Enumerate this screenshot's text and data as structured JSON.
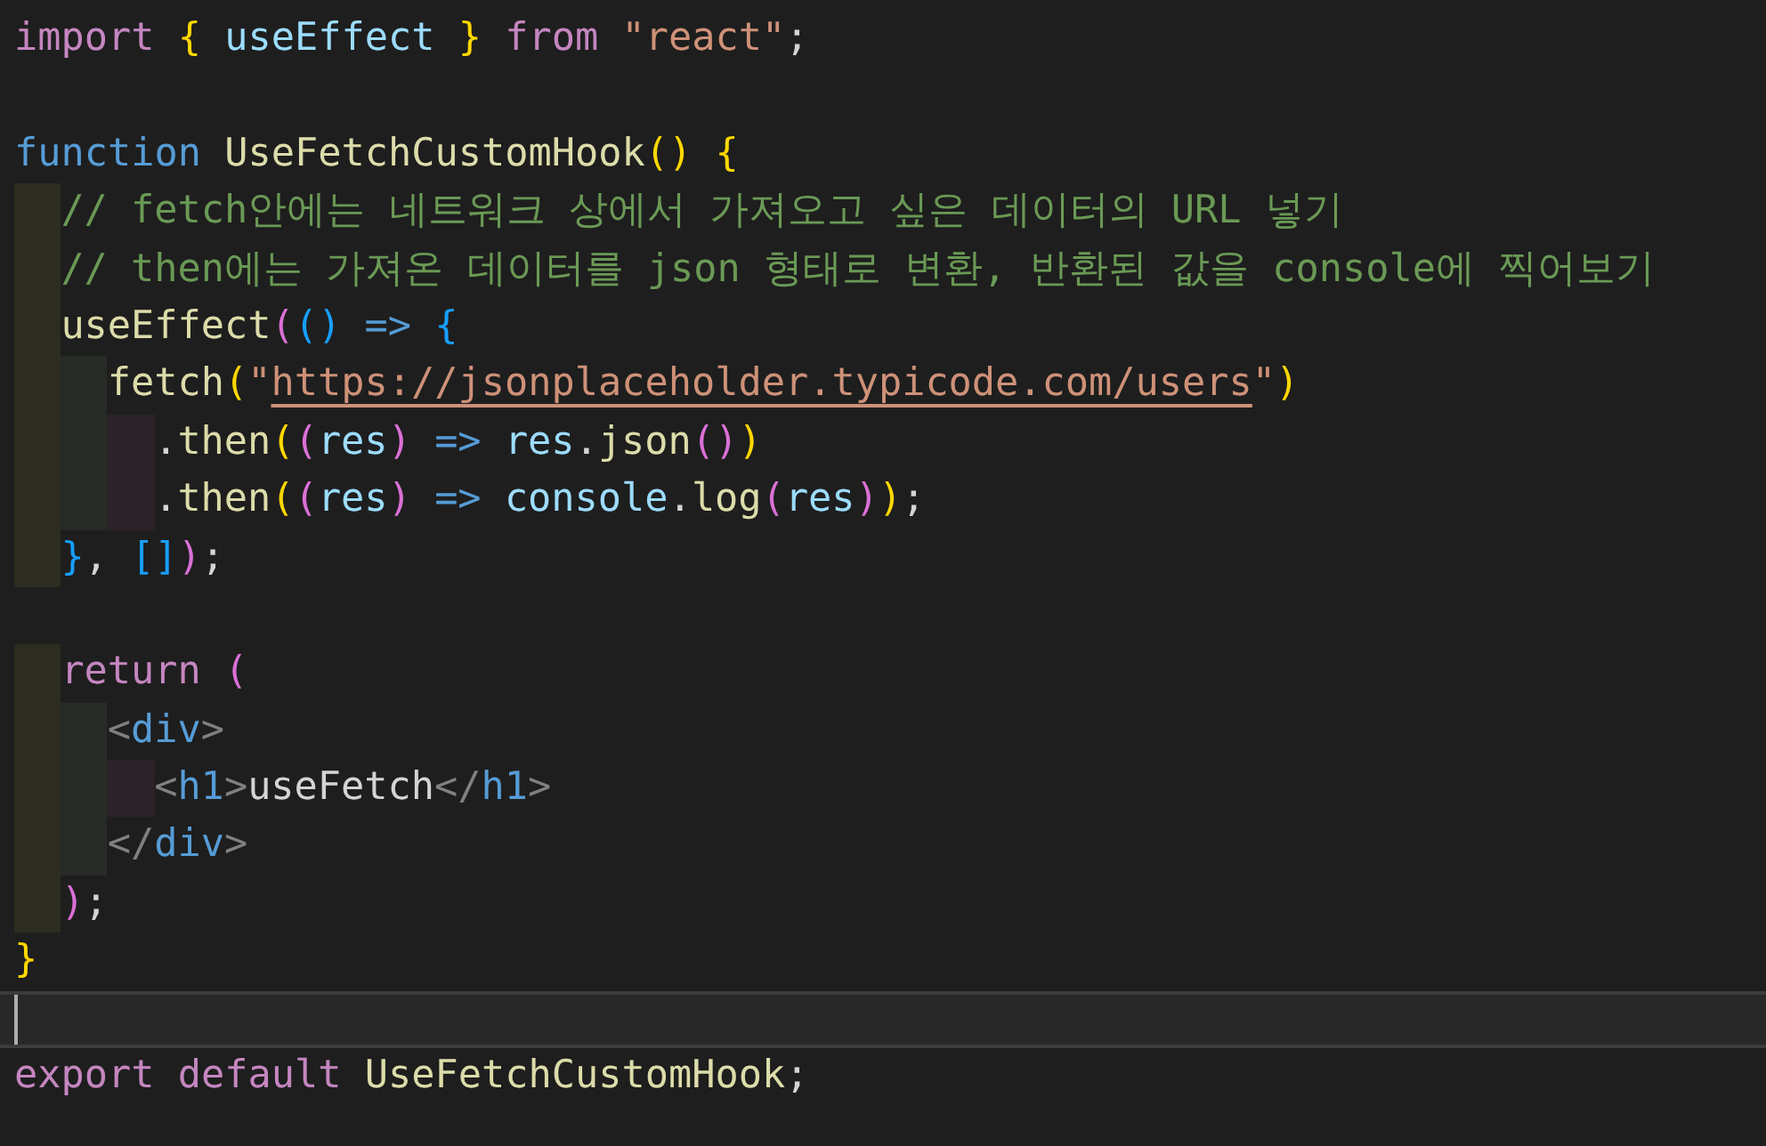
{
  "editor": {
    "lines": [
      {
        "cursor": false,
        "tokens": [
          {
            "kind": "keyword",
            "text": "import "
          },
          {
            "kind": "bracket1",
            "text": "{"
          },
          {
            "kind": "variable",
            "text": " useEffect "
          },
          {
            "kind": "bracket1",
            "text": "} "
          },
          {
            "kind": "keyword",
            "text": "from "
          },
          {
            "kind": "string",
            "text": "\"react\""
          },
          {
            "kind": "punct",
            "text": ";"
          }
        ]
      },
      {
        "cursor": false
      },
      {
        "cursor": false,
        "tokens": [
          {
            "kind": "storage",
            "text": "function "
          },
          {
            "kind": "function",
            "text": "UseFetchCustomHook"
          },
          {
            "kind": "bracket1",
            "text": "() "
          },
          {
            "kind": "bracket1",
            "text": "{"
          }
        ]
      },
      {
        "cursor": false,
        "tokens": [
          {
            "kind": "comment",
            "text": "  // fetch안에는 네트워크 상에서 가져오고 싶은 데이터의 URL 넣기"
          }
        ]
      },
      {
        "cursor": false,
        "tokens": [
          {
            "kind": "comment",
            "text": "  // then에는 가져온 데이터를 json 형태로 변환, 반환된 값을 console에 찍어보기"
          }
        ]
      },
      {
        "cursor": false,
        "tokens": [
          {
            "kind": "function",
            "text": "  useEffect"
          },
          {
            "kind": "bracket2",
            "text": "("
          },
          {
            "kind": "bracket3",
            "text": "() "
          },
          {
            "kind": "storage",
            "text": "=> "
          },
          {
            "kind": "bracket3",
            "text": "{"
          }
        ]
      },
      {
        "cursor": false,
        "tokens": [
          {
            "kind": "function",
            "text": "    fetch"
          },
          {
            "kind": "bracket1",
            "text": "("
          },
          {
            "kind": "string",
            "text": "\""
          },
          {
            "kind": "url",
            "text": "https://jsonplaceholder.typicode.com/users"
          },
          {
            "kind": "string",
            "text": "\""
          },
          {
            "kind": "bracket1",
            "text": ")"
          }
        ]
      },
      {
        "cursor": false,
        "tokens": [
          {
            "kind": "punct",
            "text": "      ."
          },
          {
            "kind": "function",
            "text": "then"
          },
          {
            "kind": "bracket1",
            "text": "("
          },
          {
            "kind": "bracket2",
            "text": "("
          },
          {
            "kind": "variable",
            "text": "res"
          },
          {
            "kind": "bracket2",
            "text": ") "
          },
          {
            "kind": "storage",
            "text": "=> "
          },
          {
            "kind": "variable",
            "text": "res"
          },
          {
            "kind": "punct",
            "text": "."
          },
          {
            "kind": "function",
            "text": "json"
          },
          {
            "kind": "bracket2",
            "text": "()"
          },
          {
            "kind": "bracket1",
            "text": ")"
          }
        ]
      },
      {
        "cursor": false,
        "tokens": [
          {
            "kind": "punct",
            "text": "      ."
          },
          {
            "kind": "function",
            "text": "then"
          },
          {
            "kind": "bracket1",
            "text": "("
          },
          {
            "kind": "bracket2",
            "text": "("
          },
          {
            "kind": "variable",
            "text": "res"
          },
          {
            "kind": "bracket2",
            "text": ") "
          },
          {
            "kind": "storage",
            "text": "=> "
          },
          {
            "kind": "variable",
            "text": "console"
          },
          {
            "kind": "punct",
            "text": "."
          },
          {
            "kind": "function",
            "text": "log"
          },
          {
            "kind": "bracket2",
            "text": "("
          },
          {
            "kind": "variable",
            "text": "res"
          },
          {
            "kind": "bracket2",
            "text": ")"
          },
          {
            "kind": "bracket1",
            "text": ")"
          },
          {
            "kind": "punct",
            "text": ";"
          }
        ]
      },
      {
        "cursor": false,
        "tokens": [
          {
            "kind": "bracket3",
            "text": "  }"
          },
          {
            "kind": "punct",
            "text": ", "
          },
          {
            "kind": "bracket3",
            "text": "[]"
          },
          {
            "kind": "bracket2",
            "text": ")"
          },
          {
            "kind": "punct",
            "text": ";"
          }
        ]
      },
      {
        "cursor": false
      },
      {
        "cursor": false,
        "tokens": [
          {
            "kind": "keyword",
            "text": "  return "
          },
          {
            "kind": "bracket2",
            "text": "("
          }
        ]
      },
      {
        "cursor": false,
        "tokens": [
          {
            "kind": "angle",
            "text": "    <"
          },
          {
            "kind": "tag",
            "text": "div"
          },
          {
            "kind": "angle",
            "text": ">"
          }
        ]
      },
      {
        "cursor": false,
        "tokens": [
          {
            "kind": "angle",
            "text": "      <"
          },
          {
            "kind": "tag",
            "text": "h1"
          },
          {
            "kind": "angle",
            "text": ">"
          },
          {
            "kind": "text",
            "text": "useFetch"
          },
          {
            "kind": "angle",
            "text": "</"
          },
          {
            "kind": "tag",
            "text": "h1"
          },
          {
            "kind": "angle",
            "text": ">"
          }
        ]
      },
      {
        "cursor": false,
        "tokens": [
          {
            "kind": "angle",
            "text": "    </"
          },
          {
            "kind": "tag",
            "text": "div"
          },
          {
            "kind": "angle",
            "text": ">"
          }
        ]
      },
      {
        "cursor": false,
        "tokens": [
          {
            "kind": "bracket2",
            "text": "  )"
          },
          {
            "kind": "punct",
            "text": ";"
          }
        ]
      },
      {
        "cursor": false,
        "tokens": [
          {
            "kind": "bracket1",
            "text": "}"
          }
        ]
      },
      {
        "cursor": true
      },
      {
        "cursor": false,
        "tokens": [
          {
            "kind": "keyword",
            "text": "export "
          },
          {
            "kind": "keyword",
            "text": "default "
          },
          {
            "kind": "function",
            "text": "UseFetchCustomHook"
          },
          {
            "kind": "punct",
            "text": ";"
          }
        ]
      }
    ]
  }
}
